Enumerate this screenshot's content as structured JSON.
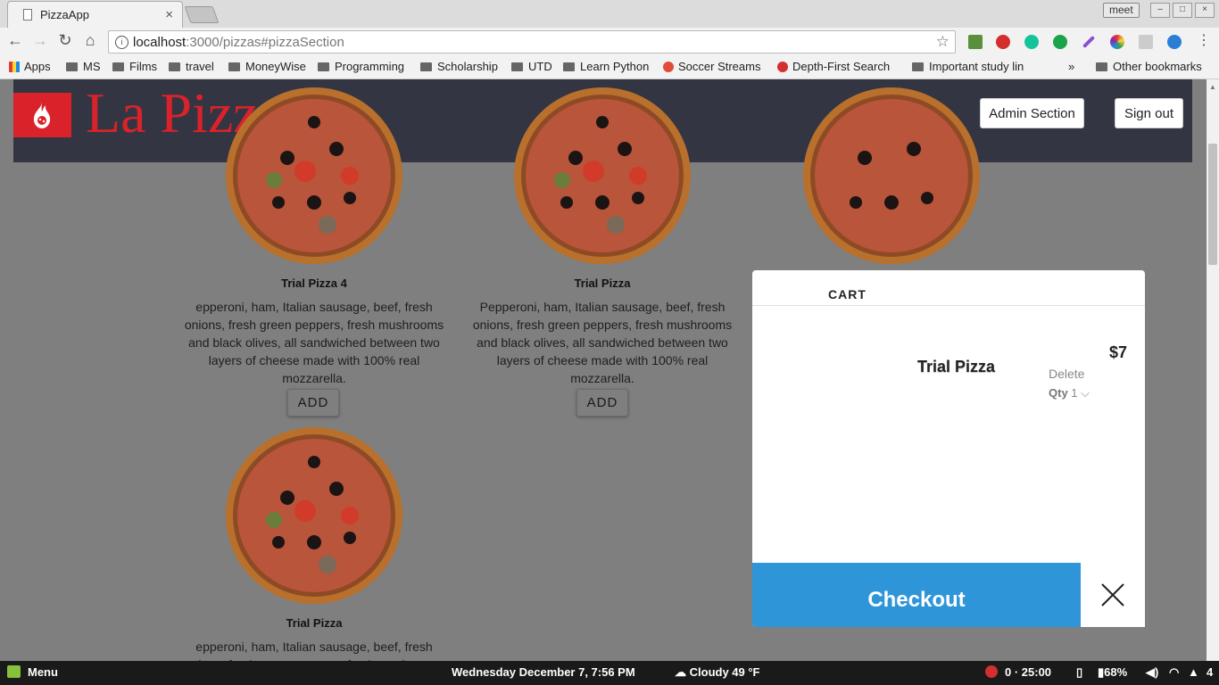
{
  "browser": {
    "tab_title": "PizzaApp",
    "tab_close": "×",
    "profile": "meet",
    "url_host": "localhost",
    "url_rest": ":3000/pizzas#pizzaSection",
    "bookmarks": [
      "Apps",
      "MS",
      "Films",
      "travel",
      "MoneyWise",
      "Programming",
      "Scholarship",
      "UTD",
      "Learn Python",
      "Soccer Streams",
      "Depth-First Search",
      "Important study lin",
      "»",
      "Other bookmarks"
    ]
  },
  "header": {
    "brand": "La Pizzaria",
    "admin_button": "Admin Section",
    "signout_button": "Sign out"
  },
  "pizzas": [
    {
      "name": "Trial Pizza 4",
      "description": "epperoni, ham, Italian sausage, beef, fresh onions, fresh green peppers, fresh mushrooms and black olives, all sandwiched between two layers of cheese made with 100% real mozzarella.",
      "button": "ADD"
    },
    {
      "name": "Trial Pizza",
      "description": "Pepperoni, ham, Italian sausage, beef, fresh onions, fresh green peppers, fresh mushrooms and black olives, all sandwiched between two layers of cheese made with 100% real mozzarella.",
      "button": "ADD"
    },
    {
      "name": "Trial Pizza",
      "description": "epperoni, ham, Italian sausage, beef, fresh onions, fresh green peppers, fresh mushrooms"
    }
  ],
  "cart": {
    "title": "CART",
    "item_name": "Trial Pizza",
    "delete_label": "Delete",
    "qty_label": "Qty",
    "qty_value": "1",
    "price": "$7",
    "checkout_label": "Checkout"
  },
  "taskbar": {
    "menu": "Menu",
    "datetime": "Wednesday December  7,  7:56 PM",
    "weather": "Cloudy 49 °F",
    "pomodoro": "0 · 25:00",
    "battery": "68%",
    "workspace": "4"
  },
  "colors": {
    "brand_red": "#d9222a",
    "header_bg": "#333543",
    "checkout_blue": "#2f95d9",
    "overlay_gray": "#7f7f7f"
  }
}
